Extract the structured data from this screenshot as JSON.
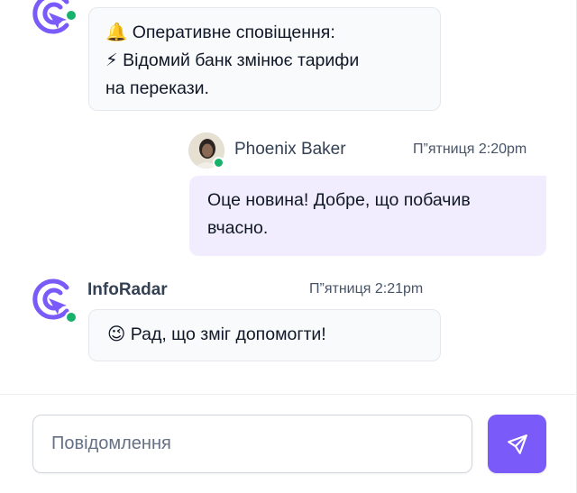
{
  "messages": [
    {
      "sender": "",
      "time": "",
      "lines": [
        "🔔 Оперативне сповіщення:",
        " ⚡ Відомий банк змінює тарифи",
        "на перекази."
      ]
    },
    {
      "sender": "Phoenix Baker",
      "time": "П”ятниця 2:20pm",
      "lines": [
        "Оце новина! Добре, що побачив",
        "вчасно."
      ]
    },
    {
      "sender": "InfoRadar",
      "time": "П”ятниця 2:21pm",
      "lines": [
        "😉 Рад, що зміг допомогти!"
      ]
    }
  ],
  "composer": {
    "placeholder": "Повідомлення",
    "value": ""
  },
  "icons": {
    "bot_avatar": "inforadar-logo-icon",
    "send": "send-icon"
  },
  "colors": {
    "accent": "#7a5af8",
    "online": "#17b26a",
    "outgoing_bubble": "#f1edfe",
    "incoming_bubble": "#f9fafb"
  }
}
